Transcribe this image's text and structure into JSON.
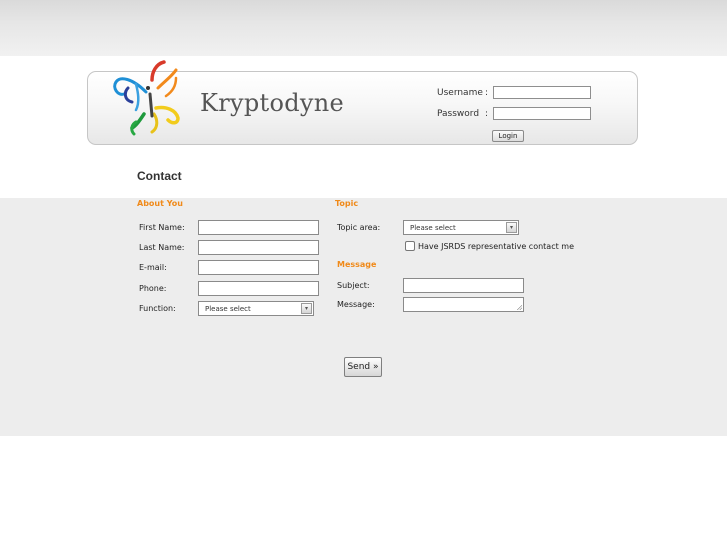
{
  "header": {
    "brand_name": "Kryptodyne",
    "logo_icon": "butterfly-logo",
    "login": {
      "username_label": "Username",
      "password_label": "Password",
      "colon": ":",
      "button_label": "Login"
    }
  },
  "page": {
    "title": "Contact"
  },
  "about_you": {
    "heading": "About You",
    "first_name_label": "First Name:",
    "last_name_label": "Last Name:",
    "email_label": "E-mail:",
    "phone_label": "Phone:",
    "function_label": "Function:",
    "function_value": "Please select"
  },
  "topic": {
    "heading": "Topic",
    "topic_area_label": "Topic area:",
    "topic_area_value": "Please select",
    "contact_checkbox_label": "Have JSRDS representative contact me"
  },
  "message": {
    "heading": "Message",
    "subject_label": "Subject:",
    "message_label": "Message:"
  },
  "send_label": "Send »",
  "colors": {
    "accent": "#f08a1a",
    "form_bg": "#ededed"
  }
}
